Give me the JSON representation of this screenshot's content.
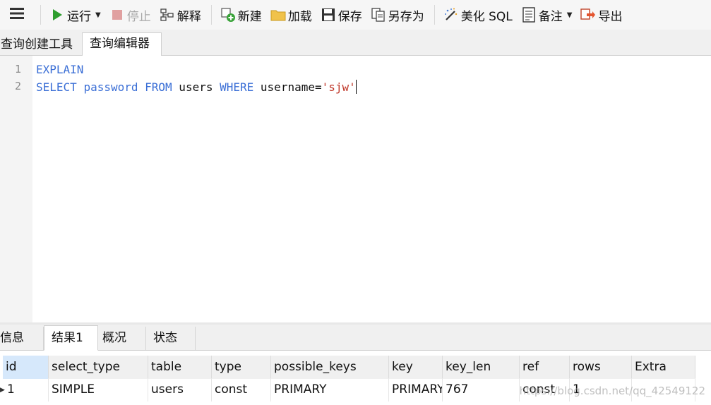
{
  "toolbar": {
    "run_label": "运行",
    "stop_label": "停止",
    "explain_label": "解释",
    "new_label": "新建",
    "load_label": "加载",
    "save_label": "保存",
    "save_as_label": "另存为",
    "beautify_label": "美化 SQL",
    "note_label": "备注",
    "export_label": "导出"
  },
  "top_tabs": [
    "查询创建工具",
    "查询编辑器"
  ],
  "editor": {
    "line_numbers": [
      "1",
      "2"
    ],
    "line1": {
      "kw1": "EXPLAIN"
    },
    "line2": {
      "kw_select": "SELECT",
      "t_space1": " ",
      "kw_password": "password",
      "t_space2": " ",
      "kw_from": "FROM",
      "t_users": " users ",
      "kw_where": "WHERE",
      "t_cond": " username=",
      "str_val": "'sjw'"
    }
  },
  "result_tabs": [
    "信息",
    "结果1",
    "概况",
    "状态"
  ],
  "grid": {
    "columns": [
      "id",
      "select_type",
      "table",
      "type",
      "possible_keys",
      "key",
      "key_len",
      "ref",
      "rows",
      "Extra"
    ],
    "row": [
      "1",
      "SIMPLE",
      "users",
      "const",
      "PRIMARY",
      "PRIMARY",
      "767",
      "const",
      "1",
      ""
    ]
  },
  "watermark": "https://blog.csdn.net/qq_42549122",
  "colors": {
    "keyword": "#3b6fd6",
    "string": "#c0392b",
    "run_icon": "#2e9e2e",
    "stop_icon": "#e0a0a0",
    "selected_header": "#d6e8fb"
  }
}
